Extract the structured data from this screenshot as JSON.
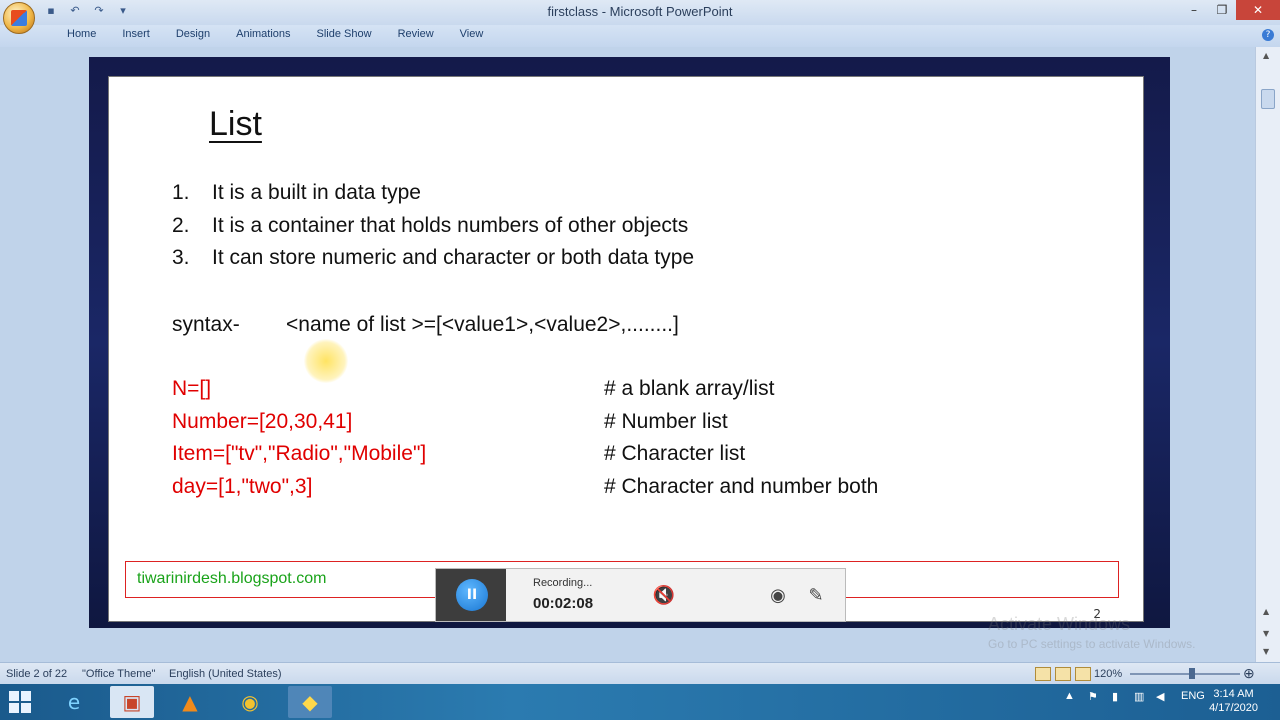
{
  "window": {
    "title": "firstclass - Microsoft PowerPoint",
    "minimize": "–",
    "maximize": "❐",
    "close": "✕"
  },
  "ribbon": {
    "tabs": [
      "Home",
      "Insert",
      "Design",
      "Animations",
      "Slide Show",
      "Review",
      "View"
    ]
  },
  "slide": {
    "title": "List",
    "points": [
      {
        "num": "1.",
        "text": "It is a built in data type"
      },
      {
        "num": "2.",
        "text": "It is a container that holds numbers of other objects"
      },
      {
        "num": "3.",
        "text": "It can store numeric and character or both data type"
      }
    ],
    "syntax_label": "syntax-",
    "syntax_text": "<name of list >=[<value1>,<value2>,........]",
    "code_lines": [
      "N=[]",
      "Number=[20,30,41]",
      "Item=[\"tv\",\"Radio\",\"Mobile\"]",
      "day=[1,\"two\",3]"
    ],
    "comments": [
      "# a blank array/list",
      "# Number list",
      "# Character list",
      "# Character and number both"
    ],
    "footer": "tiwarinirdesh.blogspot.com",
    "number": "2"
  },
  "recorder": {
    "status": "Recording...",
    "time": "00:02:08",
    "pause_icon": "pause-icon",
    "mute_icon": "speaker-mute-icon",
    "webcam_icon": "webcam-icon",
    "pen_icon": "pen-icon"
  },
  "watermark": {
    "line1": "Activate Windows",
    "line2": "Go to PC settings to activate Windows."
  },
  "statusbar": {
    "slide_info": "Slide 2 of 22",
    "theme": "\"Office Theme\"",
    "language": "English (United States)",
    "zoom": "120%",
    "zoom_level_percent": 120
  },
  "taskbar": {
    "language": "ENG",
    "time": "3:14 AM",
    "date": "4/17/2020"
  },
  "colors": {
    "code_red": "#e00000",
    "footer_green": "#1aa31a",
    "slide_frame": "#1a2766"
  }
}
